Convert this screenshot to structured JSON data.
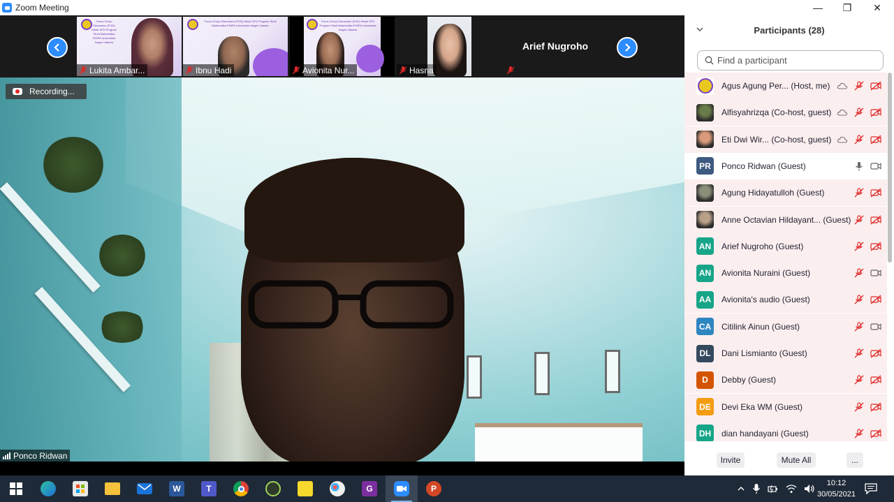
{
  "window": {
    "title": "Zoom Meeting",
    "minimize_glyph": "—",
    "restore_glyph": "❐",
    "close_glyph": "✕"
  },
  "gallery": {
    "thumbnails": [
      {
        "name": "Lukita Ambar...",
        "muted": true
      },
      {
        "name": "Ibnu Hadi",
        "muted": true
      },
      {
        "name": "Avionita Nur...",
        "muted": true
      },
      {
        "name": "Hasna",
        "muted": true
      },
      {
        "name": "",
        "muted": true
      }
    ],
    "name_tile": "Arief Nugroho",
    "slide_text": "Focus Group Discussion (FGD) Hibah SFD Program Studi Matematika FMIPA Universitas Negeri Jakarta",
    "slide_date": "Minggu, 30 Mei 2021"
  },
  "main_video": {
    "recording_label": "Recording...",
    "speaker_name": "Ponco Ridwan"
  },
  "participants": {
    "header": "Participants (28)",
    "search_placeholder": "Find a participant",
    "rows": [
      {
        "name": "Agus Agung Per...  (Host, me)",
        "avatar_type": "logo",
        "initials": "",
        "color": "#e8c820",
        "mic": "muted",
        "video": "off",
        "cloud": true,
        "highlight": true
      },
      {
        "name": "Alfisyahrizqa  (Co-host, guest)",
        "avatar_type": "photo",
        "initials": "",
        "color": "#6a7b4a",
        "mic": "muted",
        "video": "off",
        "cloud": true,
        "highlight": true
      },
      {
        "name": "Eti Dwi Wir...  (Co-host, guest)",
        "avatar_type": "photo",
        "initials": "",
        "color": "#d89a7a",
        "mic": "muted",
        "video": "off",
        "cloud": true,
        "highlight": true
      },
      {
        "name": "Ponco Ridwan (Guest)",
        "avatar_type": "initials",
        "initials": "PR",
        "color": "#3d5a80",
        "mic": "on",
        "video": "on",
        "cloud": false,
        "highlight": false
      },
      {
        "name": "Agung Hidayatulloh (Guest)",
        "avatar_type": "photo",
        "initials": "",
        "color": "#8a8f7a",
        "mic": "muted",
        "video": "off",
        "cloud": false,
        "highlight": true
      },
      {
        "name": "Anne Octavian Hildayant...  (Guest)",
        "avatar_type": "photo",
        "initials": "",
        "color": "#b9a089",
        "mic": "muted",
        "video": "off",
        "cloud": false,
        "highlight": true
      },
      {
        "name": "Arief Nugroho (Guest)",
        "avatar_type": "initials",
        "initials": "AN",
        "color": "#17a589",
        "mic": "muted",
        "video": "off",
        "cloud": false,
        "highlight": true
      },
      {
        "name": "Avionita Nuraini (Guest)",
        "avatar_type": "initials",
        "initials": "AN",
        "color": "#17a589",
        "mic": "muted",
        "video": "on",
        "cloud": false,
        "highlight": true
      },
      {
        "name": "Avionita's audio (Guest)",
        "avatar_type": "initials",
        "initials": "AA",
        "color": "#17a589",
        "mic": "muted",
        "video": "off",
        "cloud": false,
        "highlight": true
      },
      {
        "name": "Citilink Ainun (Guest)",
        "avatar_type": "initials",
        "initials": "CA",
        "color": "#2e86c1",
        "mic": "muted",
        "video": "on",
        "cloud": false,
        "highlight": true
      },
      {
        "name": "Dani Lismianto (Guest)",
        "avatar_type": "initials",
        "initials": "DL",
        "color": "#34495e",
        "mic": "muted",
        "video": "off",
        "cloud": false,
        "highlight": true
      },
      {
        "name": "Debby (Guest)",
        "avatar_type": "initials",
        "initials": "D",
        "color": "#d35400",
        "mic": "muted",
        "video": "off",
        "cloud": false,
        "highlight": true
      },
      {
        "name": "Devi Eka WM (Guest)",
        "avatar_type": "initials",
        "initials": "DE",
        "color": "#f39c12",
        "mic": "muted",
        "video": "off",
        "cloud": false,
        "highlight": true
      },
      {
        "name": "dian handayani (Guest)",
        "avatar_type": "initials",
        "initials": "DH",
        "color": "#17a589",
        "mic": "muted",
        "video": "off",
        "cloud": false,
        "highlight": true
      }
    ],
    "buttons": {
      "invite": "Invite",
      "mute_all": "Mute All",
      "more": "..."
    }
  },
  "taskbar": {
    "apps": [
      "windows-start",
      "edge",
      "store",
      "file-explorer",
      "mail",
      "word",
      "teams",
      "chrome",
      "geogebra",
      "sticky-notes",
      "paint",
      "gdrive-app",
      "zoom",
      "powerpoint"
    ],
    "time": "10:12",
    "date": "30/05/2021"
  },
  "colors": {
    "accent": "#2d8cff",
    "muted_red": "#e02828",
    "taskbar": "#1f2a38"
  }
}
